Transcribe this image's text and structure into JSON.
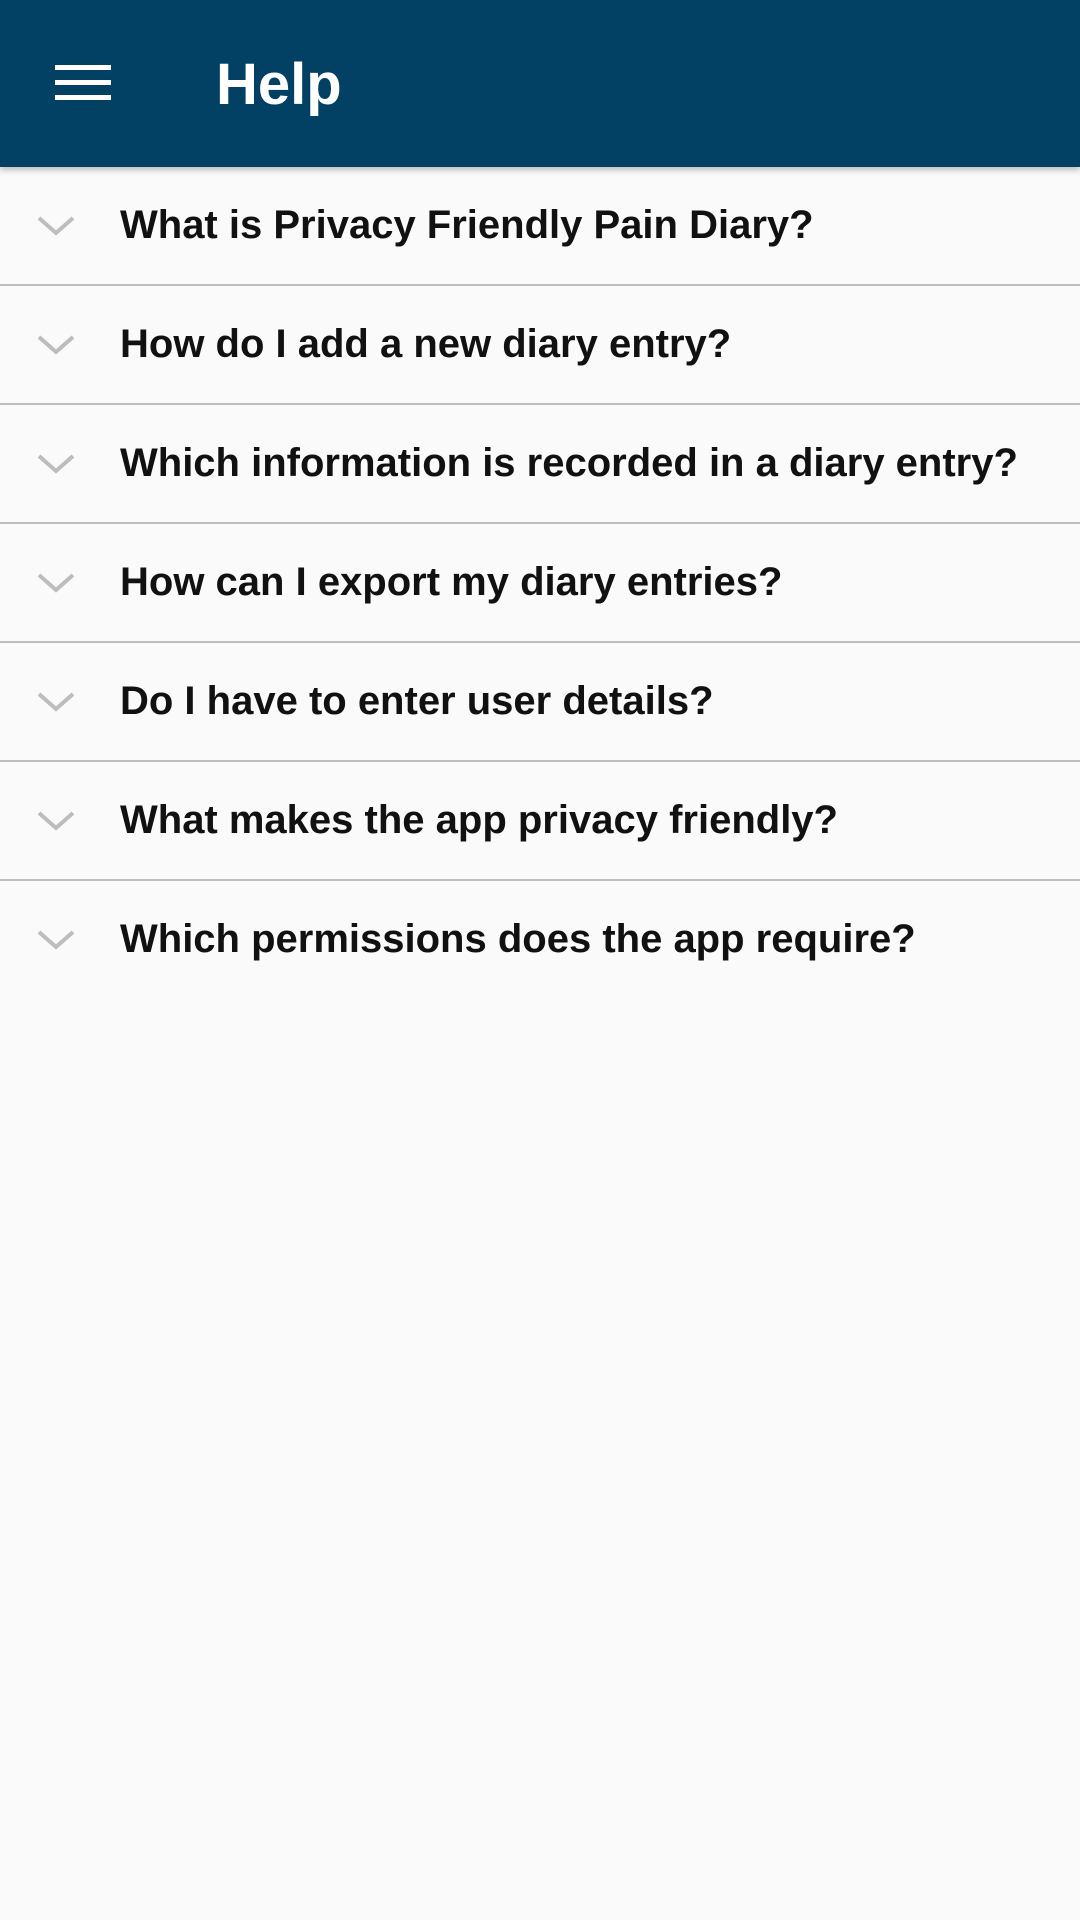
{
  "app_bar": {
    "title": "Help",
    "menu_icon": "hamburger-menu-icon",
    "background_color": "#024064"
  },
  "faq": {
    "items": [
      {
        "question": "What is Privacy Friendly Pain Diary?",
        "icon": "chevron-down-icon"
      },
      {
        "question": "How do I add a new diary entry?",
        "icon": "chevron-down-icon"
      },
      {
        "question": "Which information is recorded in a diary entry?",
        "icon": "chevron-down-icon"
      },
      {
        "question": "How can I export my diary entries?",
        "icon": "chevron-down-icon"
      },
      {
        "question": "Do I have to enter user details?",
        "icon": "chevron-down-icon"
      },
      {
        "question": "What makes the app privacy friendly?",
        "icon": "chevron-down-icon"
      },
      {
        "question": "Which permissions does the app require?",
        "icon": "chevron-down-icon"
      }
    ]
  }
}
